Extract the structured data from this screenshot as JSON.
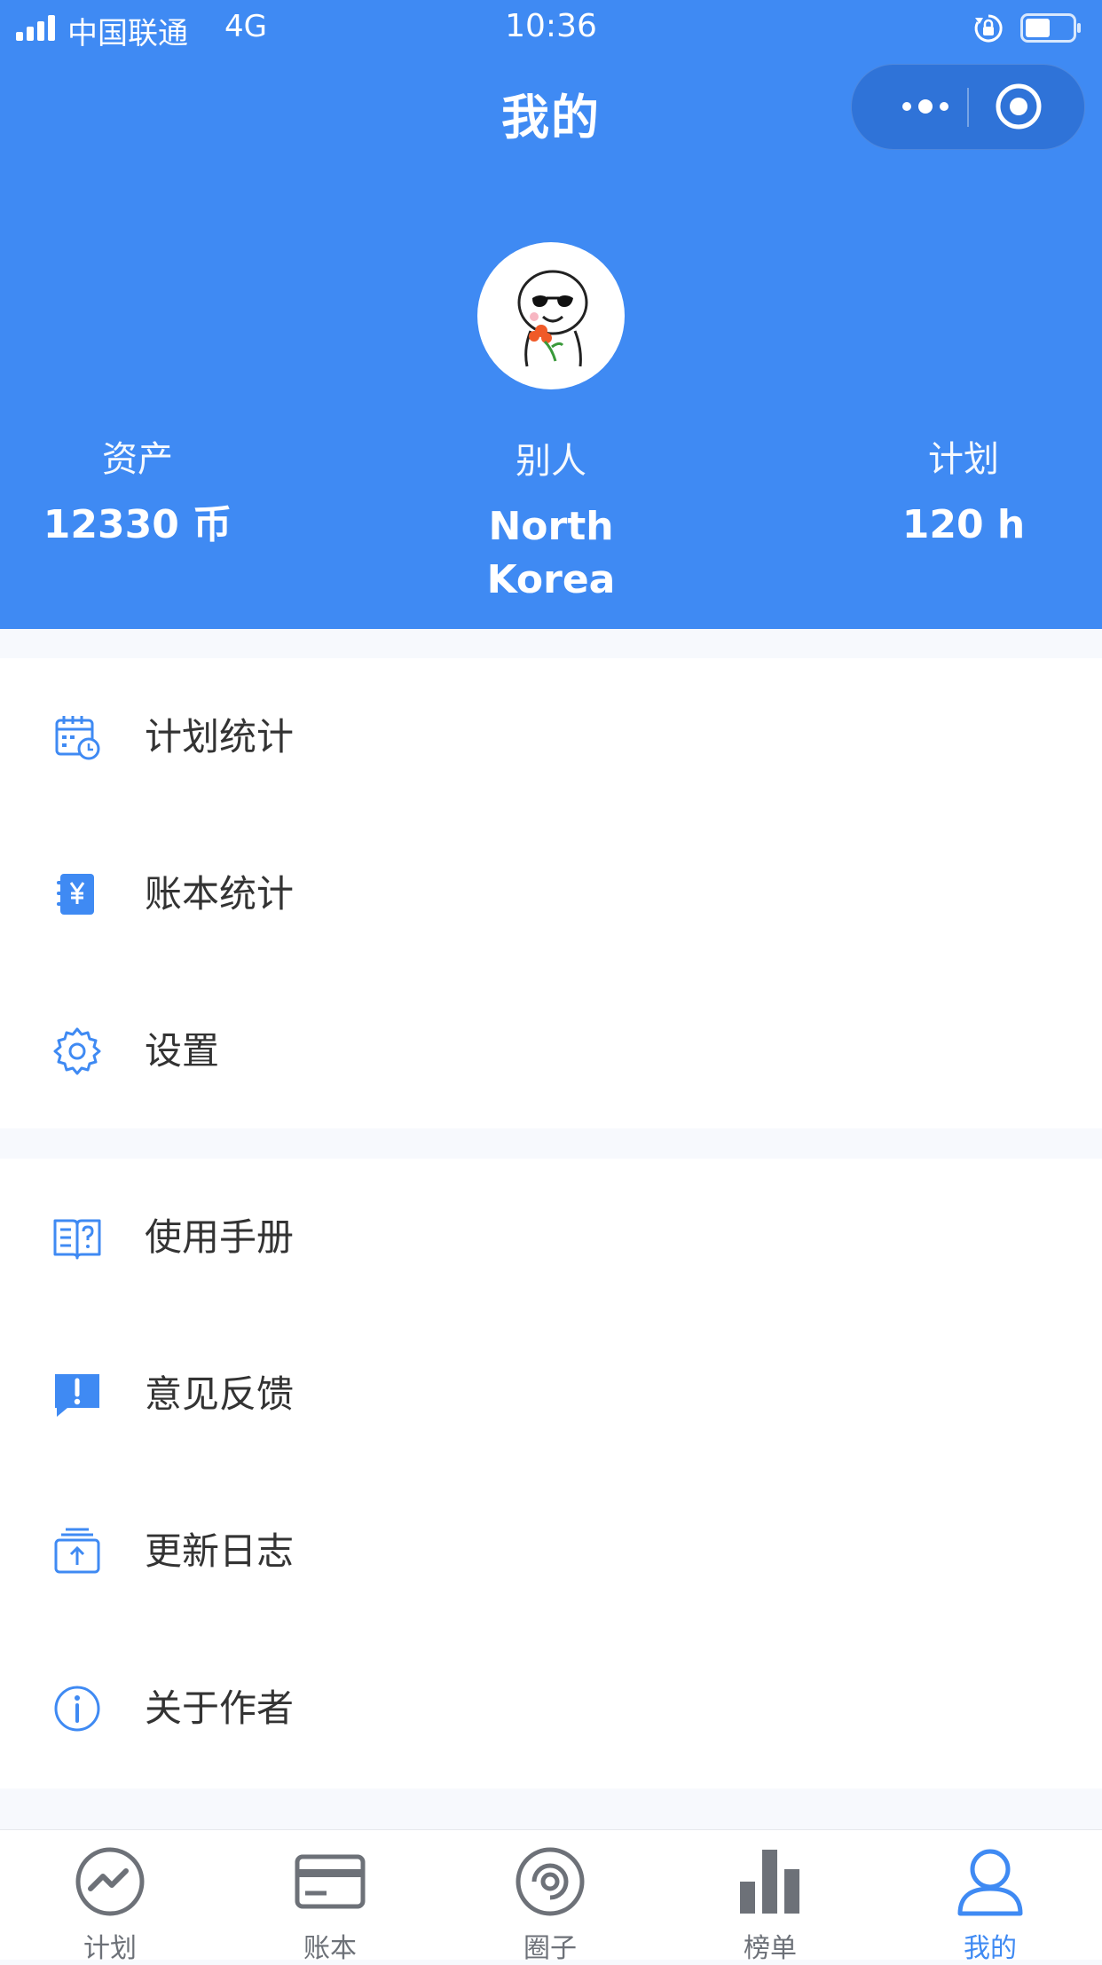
{
  "status_bar": {
    "carrier": "中国联通",
    "network": "4G",
    "time": "10:36"
  },
  "header": {
    "title": "我的",
    "stats": [
      {
        "label": "资产",
        "value": "12330 币"
      },
      {
        "label": "别人",
        "value": "North Korea"
      },
      {
        "label": "计划",
        "value": "120 h"
      }
    ]
  },
  "menu": {
    "group1": [
      {
        "label": "计划统计",
        "icon": "calendar-clock-icon"
      },
      {
        "label": "账本统计",
        "icon": "ledger-yen-icon"
      },
      {
        "label": "设置",
        "icon": "gear-icon"
      }
    ],
    "group2": [
      {
        "label": "使用手册",
        "icon": "manual-book-icon"
      },
      {
        "label": "意见反馈",
        "icon": "feedback-icon"
      },
      {
        "label": "更新日志",
        "icon": "update-log-icon"
      },
      {
        "label": "关于作者",
        "icon": "info-icon"
      }
    ]
  },
  "tabbar": {
    "items": [
      {
        "label": "计划",
        "icon": "trend-circle-icon"
      },
      {
        "label": "账本",
        "icon": "card-icon"
      },
      {
        "label": "圈子",
        "icon": "circle-ring-icon"
      },
      {
        "label": "榜单",
        "icon": "bar-chart-icon"
      },
      {
        "label": "我的",
        "icon": "user-icon"
      }
    ],
    "active": "我的"
  },
  "colors": {
    "primary": "#3f8af3",
    "tab_inactive": "#6d7178",
    "text": "#333333",
    "background": "#f7f9fd"
  }
}
